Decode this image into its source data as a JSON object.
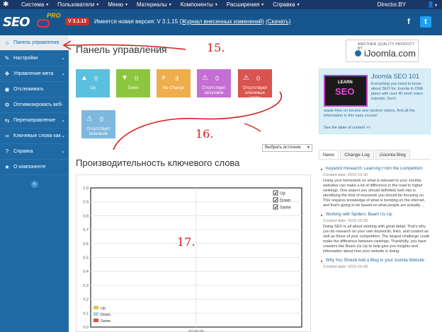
{
  "topbar": {
    "menu": [
      "Система",
      "Пользователи",
      "Меню",
      "Материалы",
      "Компоненты",
      "Расширения",
      "Справка"
    ],
    "site": "Director.BY",
    "user_icon": "user-icon"
  },
  "header": {
    "logo_text": "SEO",
    "pro": "PRO",
    "version": "V 3.1.13",
    "update_prefix": "Имеется новая версия: V 3.1.15",
    "changelog_link": "(Журнал внесенных изменений)",
    "download_link": "(Скачать)"
  },
  "sidebar": {
    "items": [
      {
        "label": "Панель управления",
        "icon": "home-icon",
        "active": true,
        "chevron": false
      },
      {
        "label": "Настройки",
        "icon": "wrench-icon",
        "active": false,
        "chevron": true
      },
      {
        "label": "Управление мета",
        "icon": "tags-icon",
        "active": false,
        "chevron": true
      },
      {
        "label": "Отслеживать",
        "icon": "eye-icon",
        "active": false,
        "chevron": false
      },
      {
        "label": "Оптимизировать веб-",
        "icon": "optimize-icon",
        "active": false,
        "chevron": false
      },
      {
        "label": "Перенаправление",
        "icon": "redirect-icon",
        "active": false,
        "chevron": true
      },
      {
        "label": "Ключевые слова как",
        "icon": "link-icon",
        "active": false,
        "chevron": true
      },
      {
        "label": "Справка",
        "icon": "help-icon",
        "active": false,
        "chevron": true
      },
      {
        "label": "О компоненте",
        "icon": "star-icon",
        "active": false,
        "chevron": false
      }
    ]
  },
  "main": {
    "title": "Панель управления",
    "badge_small": "ANOTHER QUALITY PRODUCT BY",
    "badge_big": "iJoomla.com",
    "stats": [
      {
        "label": "Up",
        "value": "0",
        "color": "#5bc0de",
        "symbol": "▲"
      },
      {
        "label": "Down",
        "value": "0",
        "color": "#8cc63f",
        "symbol": "▼"
      },
      {
        "label": "No Change",
        "value": "3",
        "color": "#f0ad4e",
        "symbol": "≠"
      },
      {
        "label": "Отсутствует заголовок",
        "value": "0",
        "color": "#c56ed3",
        "symbol": "⚠"
      },
      {
        "label": "Отсутствуют ключевые слова",
        "value": "0",
        "color": "#d9534f",
        "symbol": "⚠"
      },
      {
        "label": "Отсутствует описание",
        "value": "0",
        "color": "#7fb8de",
        "symbol": "⚠"
      }
    ],
    "source_select": "Выбрать источник",
    "perf_title": "Производительность ключевого слова"
  },
  "chart_data": {
    "type": "line",
    "ylim": [
      0,
      1
    ],
    "y_ticks": [
      "1.0",
      "0.9",
      "0.8",
      "0.7",
      "0.6",
      "0.5",
      "0.4",
      "0.3",
      "0.2",
      "0.1",
      "0.0"
    ],
    "x_ticks": [
      "00:00:00"
    ],
    "grid": true,
    "legend_top_right": [
      "Up",
      "Down",
      "Same"
    ],
    "legend_bottom_left": [
      {
        "name": "Up",
        "color": "#e8c04b"
      },
      {
        "name": "Down",
        "color": "#a8d4e8"
      },
      {
        "name": "Same",
        "color": "#d9534f"
      }
    ],
    "series": []
  },
  "promo": {
    "title": "Joomla SEO 101",
    "img_text1": "LEARN",
    "img_text2": "SEO",
    "text": "Everything you need to know about SEO for Joomla in ONE place with over 40 short video tutorials. Don't",
    "text2": "waste time on forums and random videos, find all the information in this easy course!",
    "link": "See the table of content >>"
  },
  "news": {
    "tabs": [
      "News",
      "Change Log",
      "iJoomla Blog"
    ],
    "items": [
      {
        "title": "Keyword Research: Learning From the Competition",
        "date": "Created date: 2015-10-30",
        "text": "Doing your homework on what is relevant to your Joomla websites can make a lot of difference in the road to higher rankings. One aspect you should definitely look into is identifying the kind of keywords you should be focusing on. This requires knowledge of what is trending on the internet, and that's going to be based on what people are actually ..."
      },
      {
        "title": "Working with Spiders: Beam Us Up",
        "date": "Created date: 2015-10-28",
        "text": "Doing SEO is all about working with great detail. That's why you do research on your own keywords, links, and content as well as those of your competition. The largest challenge could make the difference between rankings. Thankfully, you have crawlers like Beam Us Up to help give you insights and information about how your website is doing."
      },
      {
        "title": "Why You Should Add a Blog to your Joomla Website",
        "date": "Created date: 2015-10-28",
        "text": ""
      }
    ]
  },
  "annotations": {
    "a15": "15.",
    "a16": "16.",
    "a17": "17."
  }
}
